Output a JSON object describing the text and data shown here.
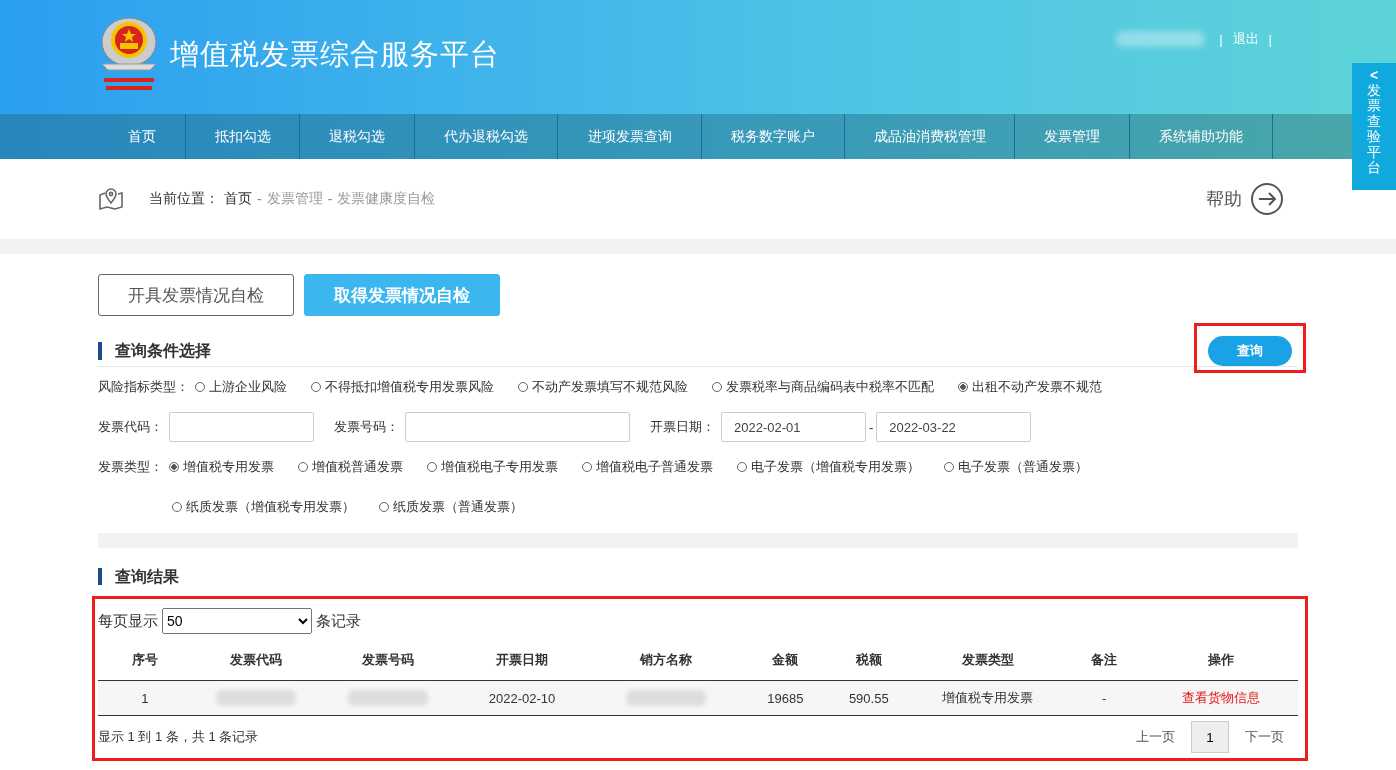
{
  "header": {
    "title": "增值税发票综合服务平台",
    "logout": "退出",
    "separator": "|"
  },
  "side_tab": {
    "arrow": "<",
    "label": "发票查验平台"
  },
  "nav": [
    {
      "label": "首页"
    },
    {
      "label": "抵扣勾选"
    },
    {
      "label": "退税勾选"
    },
    {
      "label": "代办退税勾选"
    },
    {
      "label": "进项发票查询"
    },
    {
      "label": "税务数字账户"
    },
    {
      "label": "成品油消费税管理"
    },
    {
      "label": "发票管理"
    },
    {
      "label": "系统辅助功能"
    }
  ],
  "breadcrumb": {
    "label": "当前位置：",
    "separator": "-",
    "items": [
      "首页",
      "发票管理",
      "发票健康度自检"
    ]
  },
  "help": "帮助",
  "tabs": [
    {
      "label": "开具发票情况自检",
      "selected": false
    },
    {
      "label": "取得发票情况自检",
      "selected": true
    }
  ],
  "query_section": {
    "title": "查询条件选择",
    "query_button": "查询"
  },
  "risk_type": {
    "label": "风险指标类型：",
    "options": [
      {
        "label": "上游企业风险",
        "selected": false
      },
      {
        "label": "不得抵扣增值税专用发票风险",
        "selected": false
      },
      {
        "label": "不动产发票填写不规范风险",
        "selected": false
      },
      {
        "label": "发票税率与商品编码表中税率不匹配",
        "selected": false
      },
      {
        "label": "出租不动产发票不规范",
        "selected": true
      }
    ]
  },
  "fields": {
    "code_label": "发票代码：",
    "number_label": "发票号码：",
    "date_label": "开票日期：",
    "date_from": "2022-02-01",
    "date_sep": "-",
    "date_to": "2022-03-22"
  },
  "invoice_type": {
    "label": "发票类型：",
    "options": [
      {
        "label": "增值税专用发票",
        "selected": true
      },
      {
        "label": "增值税普通发票",
        "selected": false
      },
      {
        "label": "增值税电子专用发票",
        "selected": false
      },
      {
        "label": "增值税电子普通发票",
        "selected": false
      },
      {
        "label": "电子发票（增值税专用发票）",
        "selected": false
      },
      {
        "label": "电子发票（普通发票）",
        "selected": false
      },
      {
        "label": "纸质发票（增值税专用发票）",
        "selected": false
      },
      {
        "label": "纸质发票（普通发票）",
        "selected": false
      }
    ]
  },
  "results": {
    "title": "查询结果",
    "per_page_label": "每页显示",
    "per_page": "50",
    "per_page_suffix": "条记录",
    "columns": [
      "序号",
      "发票代码",
      "发票号码",
      "开票日期",
      "销方名称",
      "金额",
      "税额",
      "发票类型",
      "备注",
      "操作"
    ],
    "rows": [
      {
        "cells": [
          {
            "kind": "text",
            "text": "1"
          },
          {
            "kind": "redacted"
          },
          {
            "kind": "redacted"
          },
          {
            "kind": "text",
            "text": "2022-02-10"
          },
          {
            "kind": "redacted"
          },
          {
            "kind": "text",
            "text": "19685"
          },
          {
            "kind": "text",
            "text": "590.55"
          },
          {
            "kind": "text",
            "text": "增值税专用发票"
          },
          {
            "kind": "text",
            "text": "-"
          },
          {
            "kind": "link",
            "text": "查看货物信息"
          }
        ]
      }
    ],
    "summary": "显示 1 到 1 条，共 1 条记录",
    "prev": "上一页",
    "pages": [
      {
        "label": "1",
        "selected": true
      }
    ],
    "next": "下一页"
  }
}
